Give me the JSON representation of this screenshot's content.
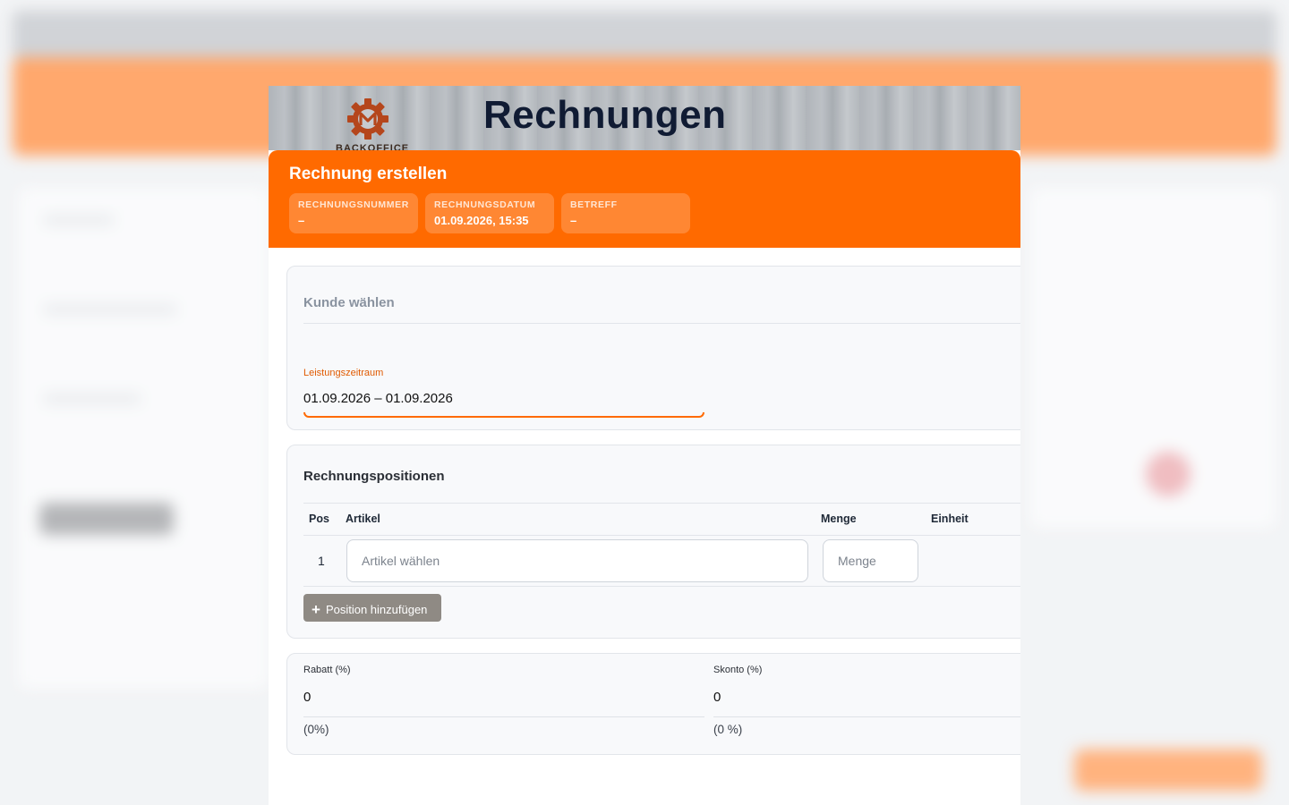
{
  "header": {
    "title": "Rechnungen",
    "logo_text": "BACKOFFICE"
  },
  "dialog": {
    "title": "Rechnung erstellen",
    "chips": [
      {
        "label": "RECHNUNGSNUMMER",
        "value": "–"
      },
      {
        "label": "RECHNUNGSDATUM",
        "value": "01.09.2026, 15:35"
      },
      {
        "label": "BETREFF",
        "value": "–"
      }
    ]
  },
  "customer": {
    "placeholder": "Kunde wählen"
  },
  "service_period": {
    "label": "Leistungszeitraum",
    "value": "01.09.2026 – 01.09.2026"
  },
  "positions": {
    "title": "Rechnungspositionen",
    "columns": {
      "pos": "Pos",
      "article": "Artikel",
      "quantity": "Menge",
      "unit": "Einheit"
    },
    "rows": [
      {
        "pos": "1",
        "article_placeholder": "Artikel wählen",
        "quantity_placeholder": "Menge"
      }
    ],
    "add_button": "Position hinzufügen"
  },
  "discounts": {
    "rabatt": {
      "label": "Rabatt (%)",
      "value": "0",
      "hint": "(0%)"
    },
    "skonto": {
      "label": "Skonto (%)",
      "value": "0",
      "hint": "(0 %)"
    }
  },
  "colors": {
    "accent": "#ff6a00",
    "title": "#101b33",
    "button": "#8f8a84"
  }
}
